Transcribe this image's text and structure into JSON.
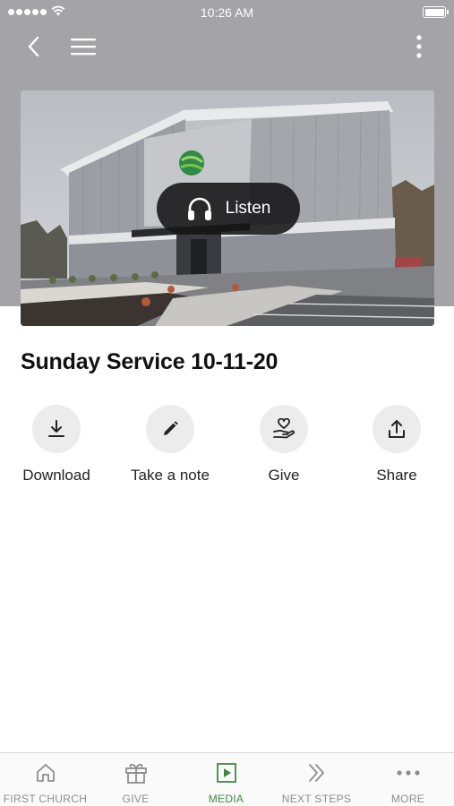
{
  "status_bar": {
    "time": "10:26 AM",
    "signal_icon": "signal-dots-icon",
    "wifi_icon": "wifi-icon",
    "battery_icon": "battery-icon"
  },
  "navbar": {
    "back_icon": "chevron-left-icon",
    "menu_icon": "hamburger-menu-icon",
    "more_icon": "vertical-ellipsis-icon"
  },
  "hero": {
    "listen_label": "Listen",
    "listen_icon": "headphones-icon"
  },
  "media": {
    "title": "Sunday Service 10-11-20"
  },
  "actions": [
    {
      "label": "Download",
      "icon": "download-icon"
    },
    {
      "label": "Take a note",
      "icon": "pencil-icon"
    },
    {
      "label": "Give",
      "icon": "heart-hand-icon"
    },
    {
      "label": "Share",
      "icon": "share-icon"
    }
  ],
  "tabbar": {
    "active_color": "#3f8a3f",
    "inactive_color": "#8d8d8d",
    "tabs": [
      {
        "label": "FIRST CHURCH",
        "icon": "home-icon",
        "active": false
      },
      {
        "label": "GIVE",
        "icon": "gift-icon",
        "active": false
      },
      {
        "label": "MEDIA",
        "icon": "play-square-icon",
        "active": true
      },
      {
        "label": "NEXT STEPS",
        "icon": "double-chevron-right-icon",
        "active": false
      },
      {
        "label": "MORE",
        "icon": "horizontal-ellipsis-icon",
        "active": false
      }
    ]
  },
  "colors": {
    "header_background": "#a3a3a8",
    "listen_button": "#141416",
    "action_circle": "#ececec"
  }
}
